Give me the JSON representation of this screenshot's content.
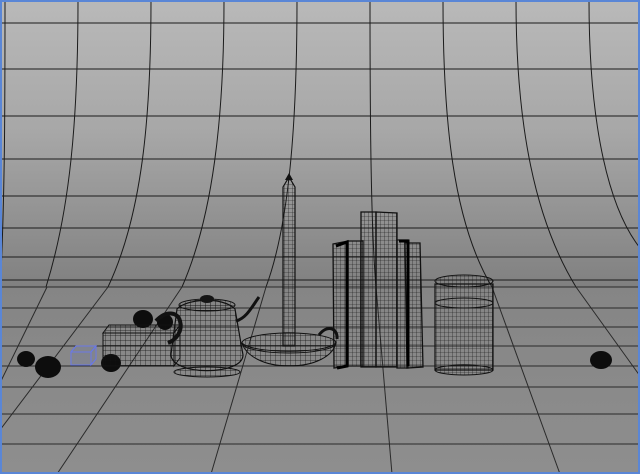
{
  "viewport": {
    "name": "3d-scene-viewport",
    "frame_color": "#5a86d6",
    "background_color": "#8f8f8f"
  },
  "scene": {
    "objects": [
      "backdrop-cyclorama",
      "floor-plane",
      "spheres",
      "selected-cube",
      "book-block",
      "teapot",
      "candle-dish",
      "book-stack",
      "cylinder-container"
    ]
  },
  "colors": {
    "wire": "#0b0b0b",
    "mesh_fill": "#6d6d6d",
    "selection": "#6070d8"
  }
}
